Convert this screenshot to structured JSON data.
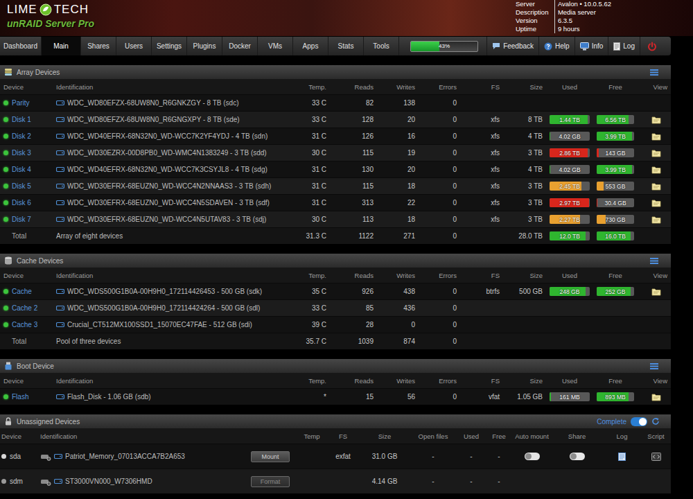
{
  "header": {
    "logo_left": "LIME",
    "logo_right": "TECH",
    "product": "unRAID Server Pro",
    "info": [
      {
        "label": "Server",
        "value": "Avalon • 10.0.5.62"
      },
      {
        "label": "Description",
        "value": "Media server"
      },
      {
        "label": "Version",
        "value": "6.3.5"
      },
      {
        "label": "Uptime",
        "value": "9 hours"
      }
    ]
  },
  "nav": {
    "tabs": [
      {
        "label": "Dashboard",
        "selected": false
      },
      {
        "label": "Main",
        "selected": true
      },
      {
        "label": "Shares",
        "selected": false
      },
      {
        "label": "Users",
        "selected": false
      },
      {
        "label": "Settings",
        "selected": false
      },
      {
        "label": "Plugins",
        "selected": false
      },
      {
        "label": "Docker",
        "selected": false
      },
      {
        "label": "VMs",
        "selected": false
      },
      {
        "label": "Apps",
        "selected": false
      },
      {
        "label": "Stats",
        "selected": false
      },
      {
        "label": "Tools",
        "selected": false
      }
    ],
    "cpu": {
      "text": "43%",
      "level": 0.43
    },
    "actions": [
      {
        "label": "Feedback",
        "kind": "feedback"
      },
      {
        "label": "Help",
        "kind": "help"
      },
      {
        "label": "Info",
        "kind": "info"
      },
      {
        "label": "Log",
        "kind": "log"
      }
    ]
  },
  "sections": [
    {
      "title": "Array Devices",
      "kind": "array",
      "columns": [
        "Device",
        "Identification",
        "Temp.",
        "Reads",
        "Writes",
        "Errors",
        "FS",
        "Size",
        "Used",
        "Free",
        "View"
      ],
      "rows": [
        {
          "kind": "device",
          "device": "Parity",
          "color": "#3cc43c",
          "identification": "WDC_WD80EFZX-68UW8N0_R6GNKZGY - 8 TB (sdc)",
          "temp": "33 C",
          "reads": "82",
          "writes": "138",
          "errors": "0",
          "fs": "",
          "size": "",
          "used": null,
          "free": null,
          "view": false
        },
        {
          "kind": "device",
          "device": "Disk 1",
          "color": "#3cc43c",
          "identification": "WDC_WD80EFZX-68UW8N0_R6GNGXPY - 8 TB (sde)",
          "temp": "33 C",
          "reads": "128",
          "writes": "20",
          "errors": "0",
          "fs": "xfs",
          "size": "8 TB",
          "used": {
            "text": "1.44 TB",
            "level": 0.95,
            "color": "#2fb52f"
          },
          "free": {
            "text": "6.56 TB",
            "level": 0.85,
            "color": "#2fb52f"
          },
          "view": true
        },
        {
          "kind": "device",
          "device": "Disk 2",
          "color": "#3cc43c",
          "identification": "WDC_WD40EFRX-68N32N0_WD-WCC7K2YF4YDJ - 4 TB (sdn)",
          "temp": "31 C",
          "reads": "126",
          "writes": "16",
          "errors": "0",
          "fs": "xfs",
          "size": "4 TB",
          "used": {
            "text": "4.02 GB",
            "level": 0.02,
            "color": "#2fb52f"
          },
          "free": {
            "text": "3.99 TB",
            "level": 0.95,
            "color": "#2fb52f"
          },
          "view": true
        },
        {
          "kind": "device",
          "device": "Disk 3",
          "color": "#3cc43c",
          "identification": "WDC_WD30EZRX-00D8PB0_WD-WMC4N1383249 - 3 TB (sdd)",
          "temp": "30 C",
          "reads": "115",
          "writes": "19",
          "errors": "0",
          "fs": "xfs",
          "size": "3 TB",
          "used": {
            "text": "2.86 TB",
            "level": 0.95,
            "color": "#d8261c"
          },
          "free": {
            "text": "143 GB",
            "level": 0.05,
            "color": "#d8261c"
          },
          "view": true
        },
        {
          "kind": "device",
          "device": "Disk 4",
          "color": "#3cc43c",
          "identification": "WDC_WD40EFRX-68N32N0_WD-WCC7K3CSYJL8 - 4 TB (sdg)",
          "temp": "31 C",
          "reads": "130",
          "writes": "20",
          "errors": "0",
          "fs": "xfs",
          "size": "4 TB",
          "used": {
            "text": "4.02 GB",
            "level": 0.02,
            "color": "#2fb52f"
          },
          "free": {
            "text": "3.99 TB",
            "level": 0.95,
            "color": "#2fb52f"
          },
          "view": true
        },
        {
          "kind": "device",
          "device": "Disk 5",
          "color": "#3cc43c",
          "identification": "WDC_WD30EFRX-68EUZN0_WD-WCC4N2NNAAS3 - 3 TB (sdh)",
          "temp": "31 C",
          "reads": "115",
          "writes": "18",
          "errors": "0",
          "fs": "xfs",
          "size": "3 TB",
          "used": {
            "text": "2.45 TB",
            "level": 0.8,
            "color": "#e8a030"
          },
          "free": {
            "text": "553 GB",
            "level": 0.18,
            "color": "#e8a030"
          },
          "view": true
        },
        {
          "kind": "device",
          "device": "Disk 6",
          "color": "#3cc43c",
          "identification": "WDC_WD30EFRX-68EUZN0_WD-WCC4N5SDAVEN - 3 TB (sdf)",
          "temp": "31 C",
          "reads": "313",
          "writes": "22",
          "errors": "0",
          "fs": "xfs",
          "size": "3 TB",
          "used": {
            "text": "2.97 TB",
            "level": 0.99,
            "color": "#d8261c"
          },
          "free": {
            "text": "30.4 GB",
            "level": 0.01,
            "color": "#d8261c"
          },
          "view": true
        },
        {
          "kind": "device",
          "device": "Disk 7",
          "color": "#3cc43c",
          "identification": "WDC_WD30EFRX-68EUZN0_WD-WCC4N5UTAV83 - 3 TB (sdj)",
          "temp": "30 C",
          "reads": "113",
          "writes": "18",
          "errors": "0",
          "fs": "xfs",
          "size": "3 TB",
          "used": {
            "text": "2.27 TB",
            "level": 0.76,
            "color": "#e8a030"
          },
          "free": {
            "text": "730 GB",
            "level": 0.24,
            "color": "#e8a030"
          },
          "view": true
        },
        {
          "kind": "total",
          "device": "Total",
          "color": "",
          "identification": "Array of eight devices",
          "temp": "31.3 C",
          "reads": "1122",
          "writes": "271",
          "errors": "0",
          "fs": "",
          "size": "28.0 TB",
          "used": {
            "text": "12.0 TB",
            "level": 0.9,
            "color": "#2fb52f"
          },
          "free": {
            "text": "16.0 TB",
            "level": 0.9,
            "color": "#2fb52f"
          },
          "view": false
        }
      ]
    },
    {
      "title": "Cache Devices",
      "kind": "cache",
      "columns": [
        "Device",
        "Identification",
        "Temp.",
        "Reads",
        "Writes",
        "Errors",
        "FS",
        "Size",
        "Used",
        "Free",
        "View"
      ],
      "rows": [
        {
          "kind": "device",
          "device": "Cache",
          "color": "#3cc43c",
          "identification": "WDC_WDS500G1B0A-00H9H0_172114426453 - 500 GB (sdk)",
          "temp": "35 C",
          "reads": "926",
          "writes": "438",
          "errors": "0",
          "fs": "btrfs",
          "size": "500 GB",
          "used": {
            "text": "248 GB",
            "level": 0.9,
            "color": "#2fb52f"
          },
          "free": {
            "text": "252 GB",
            "level": 0.9,
            "color": "#2fb52f"
          },
          "view": true
        },
        {
          "kind": "device",
          "device": "Cache 2",
          "color": "#3cc43c",
          "identification": "WDC_WDS500G1B0A-00H9H0_172114424264 - 500 GB (sdl)",
          "temp": "33 C",
          "reads": "85",
          "writes": "436",
          "errors": "0",
          "fs": "",
          "size": "",
          "used": null,
          "free": null,
          "view": false
        },
        {
          "kind": "device",
          "device": "Cache 3",
          "color": "#3cc43c",
          "identification": "Crucial_CT512MX100SSD1_15070EC47FAE - 512 GB (sdi)",
          "temp": "39 C",
          "reads": "28",
          "writes": "0",
          "errors": "0",
          "fs": "",
          "size": "",
          "used": null,
          "free": null,
          "view": false
        },
        {
          "kind": "total",
          "device": "Total",
          "color": "",
          "identification": "Pool of three devices",
          "temp": "35.7 C",
          "reads": "1039",
          "writes": "874",
          "errors": "0",
          "fs": "",
          "size": "",
          "used": null,
          "free": null,
          "view": false
        }
      ]
    },
    {
      "title": "Boot Device",
      "kind": "boot",
      "columns": [
        "Device",
        "Identification",
        "Temp.",
        "Reads",
        "Writes",
        "Errors",
        "FS",
        "Size",
        "Used",
        "Free",
        "View"
      ],
      "rows": [
        {
          "kind": "device",
          "device": "Flash",
          "color": "#3cc43c",
          "identification": "Flash_Disk - 1.06 GB (sdb)",
          "temp": "*",
          "reads": "15",
          "writes": "56",
          "errors": "0",
          "fs": "vfat",
          "size": "1.05 GB",
          "used": {
            "text": "161 MB",
            "level": 0.03,
            "color": "#2fb52f"
          },
          "free": {
            "text": "893 MB",
            "level": 0.85,
            "color": "#2fb52f"
          },
          "view": true
        }
      ]
    }
  ],
  "unassigned": {
    "title": "Unassigned Devices",
    "toggle": {
      "label": "Complete",
      "on": true
    },
    "columns": [
      "Device",
      "Identification",
      "Temp",
      "FS",
      "Size",
      "Open files",
      "Used",
      "Free",
      "Auto mount",
      "Share",
      "Log",
      "Script"
    ],
    "rows": [
      {
        "device": "sda",
        "color": "#d8d8d8",
        "identification": "Patriot_Memory_07013ACCA7B2A653",
        "button": {
          "label": "Mount",
          "disabled": false
        },
        "temp": "",
        "fs": "exfat",
        "size": "31.0 GB",
        "open_files": "-",
        "used": "-",
        "free": "-",
        "auto_mount": false,
        "share": false,
        "log": true,
        "script": true
      },
      {
        "device": "sdm",
        "color": "#9a9a9a",
        "identification": "ST3000VN000_W7306HMD",
        "button": {
          "label": "Format",
          "disabled": true
        },
        "temp": "",
        "fs": "",
        "size": "4.14 GB",
        "open_files": "-",
        "used": "-",
        "free": "-",
        "auto_mount": null,
        "share": null,
        "log": false,
        "script": false
      }
    ]
  }
}
